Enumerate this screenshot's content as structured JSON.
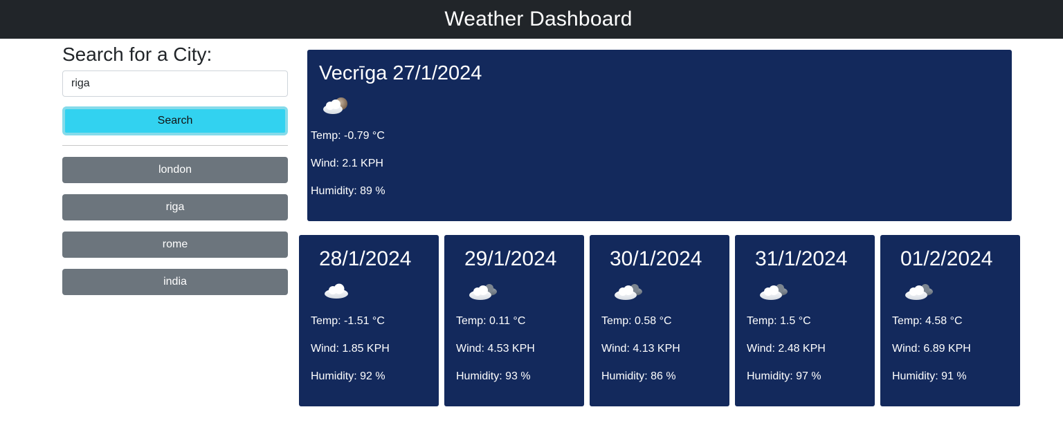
{
  "header": {
    "title": "Weather Dashboard"
  },
  "sidebar": {
    "heading": "Search for a City:",
    "search": {
      "value": "riga",
      "placeholder": ""
    },
    "search_button": "Search",
    "history": [
      "london",
      "riga",
      "rome",
      "india"
    ]
  },
  "current": {
    "title": "Vecrīga 27/1/2024",
    "icon": "partly-cloudy-night-icon",
    "temp": "Temp: -0.79 °C",
    "wind": "Wind: 2.1 KPH",
    "humidity": "Humidity: 89 %"
  },
  "forecast": [
    {
      "date": "28/1/2024",
      "icon": "cloud-icon",
      "temp": "Temp: -1.51 °C",
      "wind": "Wind: 1.85 KPH",
      "humidity": "Humidity: 92 %"
    },
    {
      "date": "29/1/2024",
      "icon": "broken-clouds-icon",
      "temp": "Temp: 0.11 °C",
      "wind": "Wind: 4.53 KPH",
      "humidity": "Humidity: 93 %"
    },
    {
      "date": "30/1/2024",
      "icon": "broken-clouds-icon",
      "temp": "Temp: 0.58 °C",
      "wind": "Wind: 4.13 KPH",
      "humidity": "Humidity: 86 %"
    },
    {
      "date": "31/1/2024",
      "icon": "broken-clouds-icon",
      "temp": "Temp: 1.5 °C",
      "wind": "Wind: 2.48 KPH",
      "humidity": "Humidity: 97 %"
    },
    {
      "date": "01/2/2024",
      "icon": "broken-clouds-icon",
      "temp": "Temp: 4.58 °C",
      "wind": "Wind: 6.89 KPH",
      "humidity": "Humidity: 91 %"
    }
  ],
  "colors": {
    "navbar": "#212529",
    "card": "#13295c",
    "search_button": "#32d2f0",
    "history_button": "#6c757d"
  }
}
